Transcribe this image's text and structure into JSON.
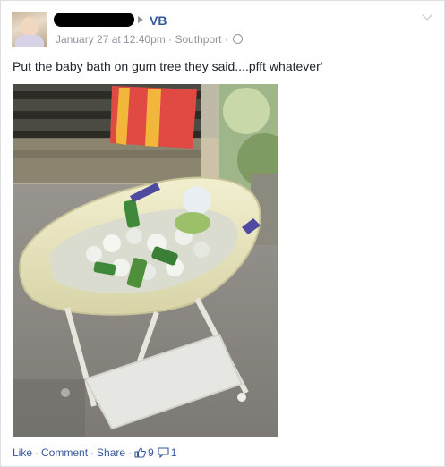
{
  "post": {
    "target_name": "VB",
    "timestamp": "January 27 at 12:40pm",
    "location": "Southport",
    "separator": "·",
    "text": "Put the baby bath on gum tree they said....pfft whatever'",
    "privacy_icon": "globe-icon",
    "options_icon": "chevron-down-icon"
  },
  "actions": {
    "like": "Like",
    "comment": "Comment",
    "share": "Share",
    "separator": "·",
    "like_count": "9",
    "comment_count": "1",
    "like_icon": "thumbs-up-icon",
    "comment_icon": "speech-bubble-icon"
  },
  "colors": {
    "link": "#365899",
    "meta": "#90949c",
    "text": "#1d2129",
    "border": "#dddfe2"
  }
}
